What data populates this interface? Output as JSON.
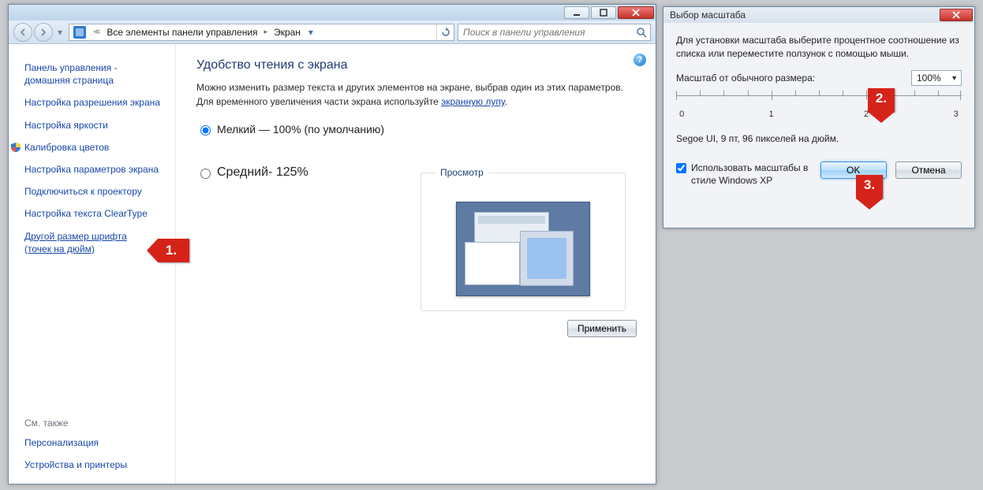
{
  "main_window": {
    "breadcrumbs": {
      "root": "Все элементы панели управления",
      "leaf": "Экран"
    },
    "search_placeholder": "Поиск в панели управления",
    "sidebar": {
      "home1": "Панель управления -",
      "home2": "домашняя страница",
      "items": [
        "Настройка разрешения экрана",
        "Настройка яркости",
        "Калибровка цветов",
        "Настройка параметров экрана",
        "Подключиться к проектору",
        "Настройка текста ClearType"
      ],
      "custom_dpi1": "Другой размер шрифта",
      "custom_dpi2": "(точек на дюйм)",
      "see_also_heading": "См. также",
      "see_also": [
        "Персонализация",
        "Устройства и принтеры"
      ]
    },
    "content": {
      "title": "Удобство чтения с экрана",
      "desc_before": "Можно изменить размер текста и других элементов на экране, выбрав один из этих параметров. Для временного увеличения части экрана используйте ",
      "desc_link": "экранную лупу",
      "desc_after": ".",
      "option_small": "Мелкий — 100% (по умолчанию)",
      "option_medium": "Средний- 125%",
      "preview_legend": "Просмотр",
      "apply": "Применить"
    }
  },
  "dialog": {
    "title": "Выбор масштаба",
    "instr": "Для установки масштаба выберите процентное соотношение из списка или переместите ползунок с помощью мыши.",
    "scale_label": "Масштаб от обычного размера:",
    "scale_value": "100%",
    "ruler_ticks": [
      "0",
      "1",
      "2",
      "3"
    ],
    "font_sample": "Segoe UI, 9 пт, 96 пикселей на дюйм.",
    "xp_check": "Использовать масштабы в стиле Windows XP",
    "ok": "OK",
    "cancel": "Отмена"
  },
  "callouts": {
    "c1": "1.",
    "c2": "2.",
    "c3": "3."
  }
}
